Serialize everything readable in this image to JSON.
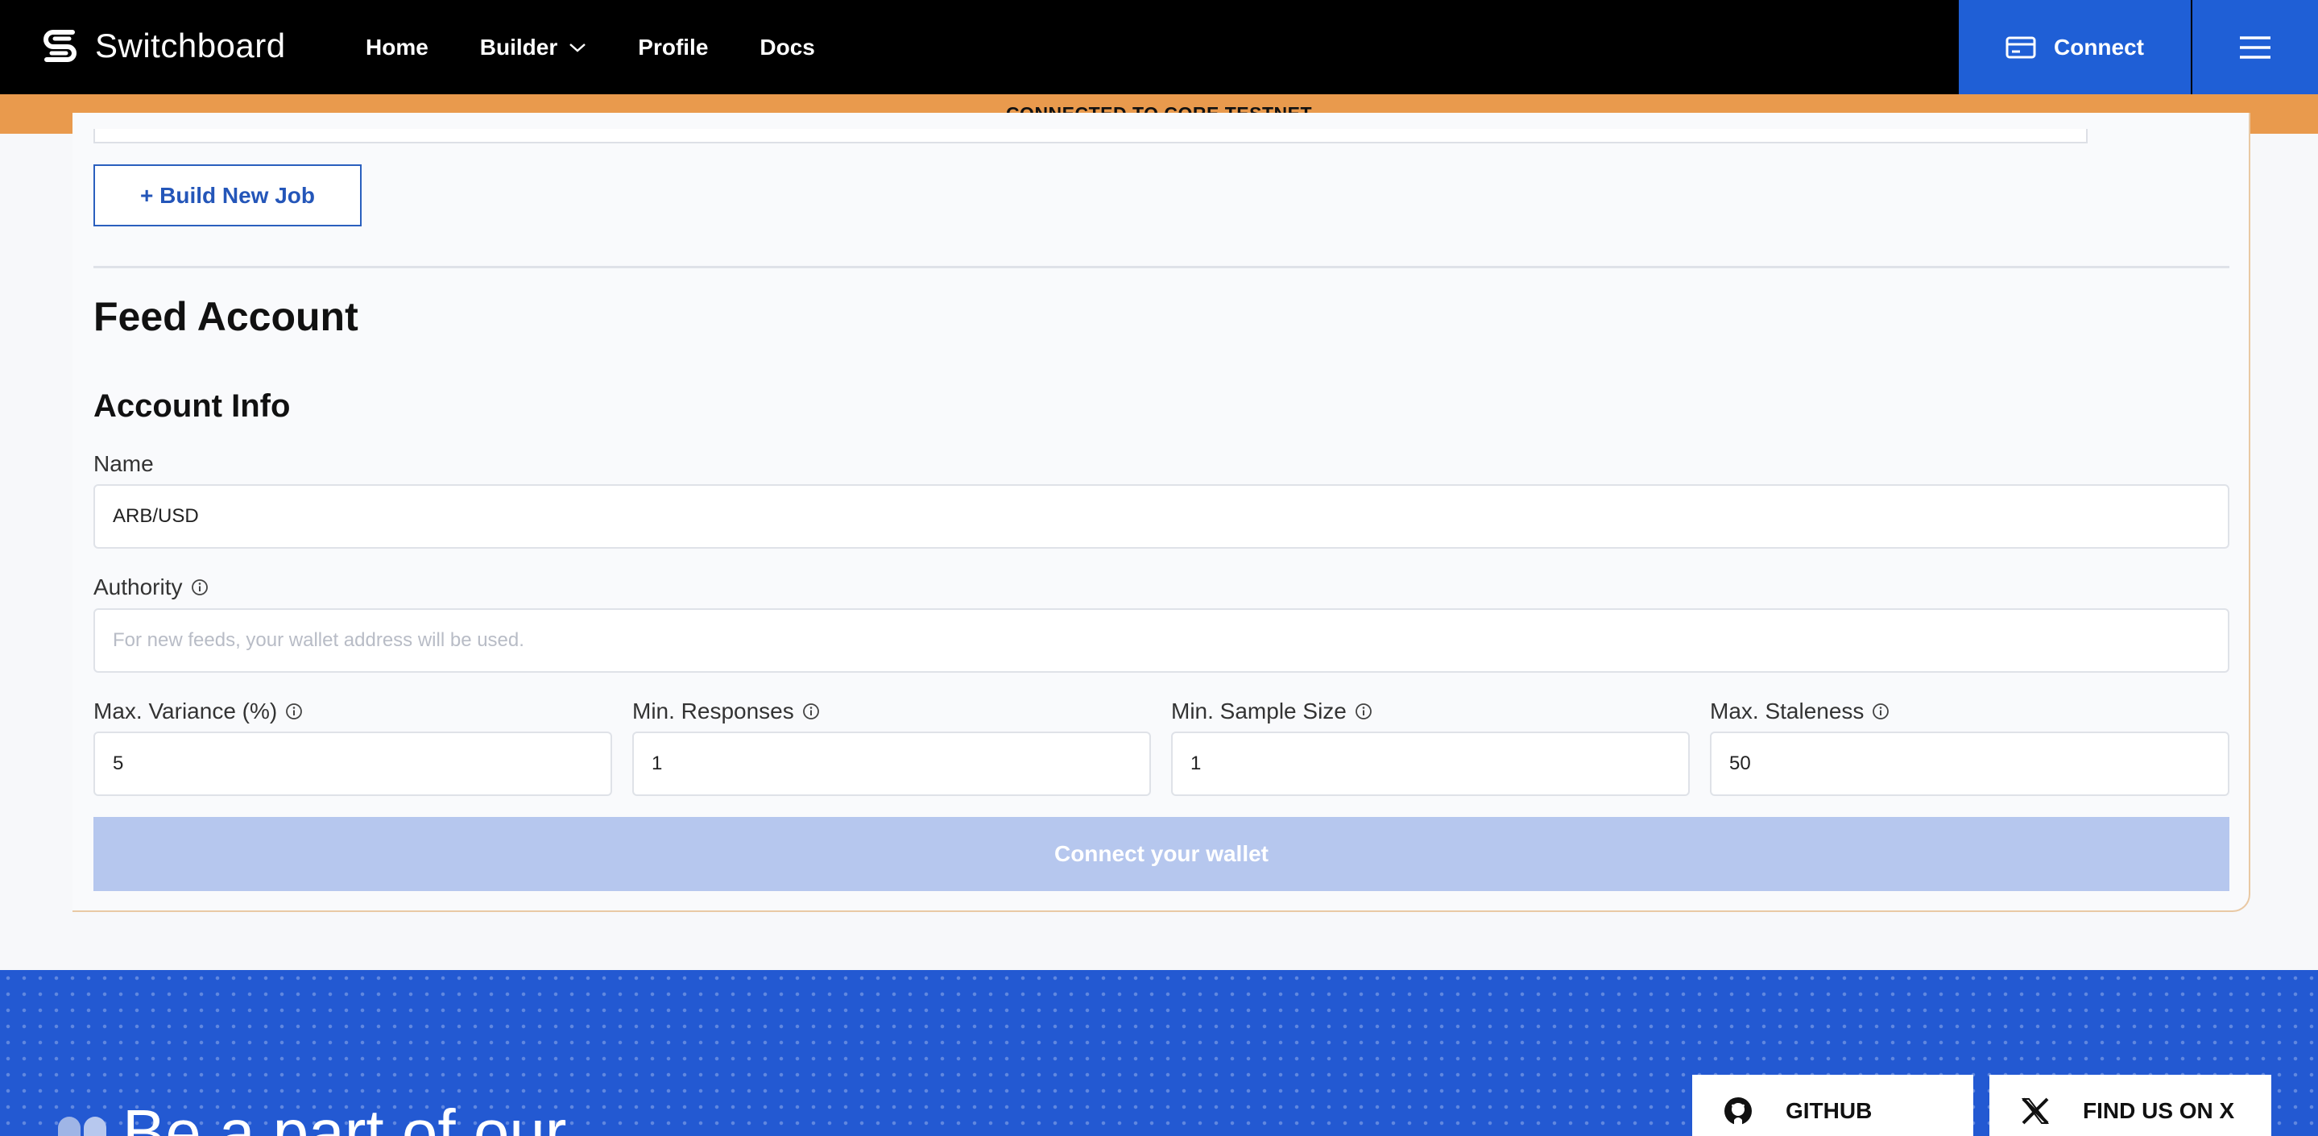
{
  "header": {
    "brand": "Switchboard",
    "nav": [
      {
        "label": "Home"
      },
      {
        "label": "Builder"
      },
      {
        "label": "Profile"
      },
      {
        "label": "Docs"
      }
    ],
    "connect_label": "Connect"
  },
  "banner": {
    "text": "CONNECTED TO CORE TESTNET"
  },
  "jobs": {
    "build_button": "+ Build New Job"
  },
  "feed_account": {
    "title": "Feed Account",
    "section": "Account Info",
    "name": {
      "label": "Name",
      "value": "ARB/USD"
    },
    "authority": {
      "label": "Authority",
      "value": "",
      "placeholder": "For new feeds, your wallet address will be used."
    },
    "max_variance": {
      "label": "Max. Variance (%)",
      "value": "5"
    },
    "min_responses": {
      "label": "Min. Responses",
      "value": "1"
    },
    "min_sample_size": {
      "label": "Min. Sample Size",
      "value": "1"
    },
    "max_staleness": {
      "label": "Max. Staleness",
      "value": "50"
    },
    "submit_label": "Connect your wallet"
  },
  "footer": {
    "title": "Be a part of our",
    "github_label": "GITHUB",
    "x_label": "FIND US ON X"
  },
  "colors": {
    "nav_bg": "#000000",
    "accent_blue": "#1f5fd6",
    "banner_orange": "#e99a4d",
    "disabled_button": "#b6c7ee",
    "footer_blue": "#2359d2"
  },
  "icons": [
    "switchboard-logo-icon",
    "chevron-down-icon",
    "wallet-card-icon",
    "hamburger-menu-icon",
    "info-icon",
    "github-icon",
    "x-logo-icon",
    "community-people-icon"
  ]
}
